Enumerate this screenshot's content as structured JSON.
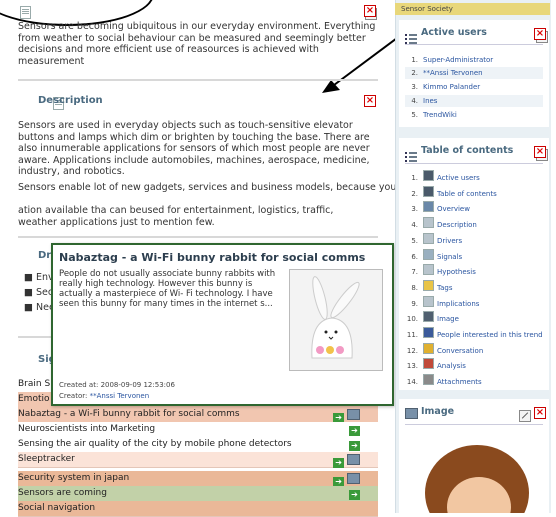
{
  "intro": {
    "text": "Sensors are becoming ubiquitous in our everyday environment. Everything from weather to social behaviour can be measured and seemingly better decisions and more efficient use of reasources is achieved with measurement"
  },
  "description": {
    "title": "Description",
    "para1": "Sensors are used in everyday objects such as touch-sensitive elevator buttons and lamps which dim or brighten by touching the base. There are also innumerable applications for sensors of which most people are never aware. Applications include automobiles, machines, aerospace, medicine, industry, and robotics.",
    "para2_line1": "Sensors enable lot of new gadgets, services and business models, because you have so much new informat",
    "para2_line2": "ation available tha can beused for entertainment, logistics, traffic, weather applications just to mention few."
  },
  "drivers": {
    "title_visible": "Dri",
    "items_visible": [
      "Env",
      "Sec",
      "Nee"
    ]
  },
  "signals": {
    "title_visible": "Sig",
    "rows": [
      {
        "text": "Brain S",
        "color": "#ffffff",
        "icons": []
      },
      {
        "text": "Emotio",
        "color": "#f1c6b0",
        "icons": []
      },
      {
        "text": "Nabaztag - a Wi-Fi bunny rabbit for social comms",
        "color": "#f1c6b0",
        "icons": [
          "go",
          "img"
        ]
      },
      {
        "text": "Neuroscientists into Marketing",
        "color": "#ffffff",
        "icons": [
          "go"
        ]
      },
      {
        "text": "Sensing the air quality of the city by mobile phone detectors",
        "color": "#ffffff",
        "icons": [
          "go"
        ]
      },
      {
        "text": "Sleeptracker",
        "color": "#fbe3d8",
        "icons": [
          "go",
          "img"
        ]
      },
      {
        "text": "Security system in japan",
        "color": "#eab898",
        "icons": [
          "go",
          "img"
        ]
      },
      {
        "text": "Sensors are coming",
        "color": "#c2d1a8",
        "icons": [
          "go"
        ]
      },
      {
        "text": "Social navigation",
        "color": "#eab898",
        "icons": []
      }
    ]
  },
  "popup": {
    "title": "Nabaztag - a Wi-Fi bunny rabbit for social comms",
    "text": "People do not usually associate bunny rabbits with really high technology. However this bunny is actually a masterpiece of Wi- Fi technology. I have seen this bunny for many times in the internet s...",
    "created_label": "Created at:",
    "created_value": "2008-09-09 12:53:06",
    "creator_label": "Creator:",
    "creator_value": "**Anssi Tervonen"
  },
  "right_panel": {
    "tab_label": "Sensor Society",
    "active_users": {
      "title": "Active users",
      "items": [
        {
          "num": "1.",
          "name": "Super-Administrator"
        },
        {
          "num": "2.",
          "name": "**Anssi Tervonen"
        },
        {
          "num": "3.",
          "name": "Kimmo Palander"
        },
        {
          "num": "4.",
          "name": "Ines"
        },
        {
          "num": "5.",
          "name": "TrendWiki"
        }
      ]
    },
    "toc": {
      "title": "Table of contents",
      "items": [
        {
          "num": "1.",
          "label": "Active users",
          "icon": "list-icon"
        },
        {
          "num": "2.",
          "label": "Table of contents",
          "icon": "list-icon"
        },
        {
          "num": "3.",
          "label": "Overview",
          "icon": "window-icon"
        },
        {
          "num": "4.",
          "label": "Description",
          "icon": "doc-icon"
        },
        {
          "num": "5.",
          "label": "Drivers",
          "icon": "doc-icon"
        },
        {
          "num": "6.",
          "label": "Signals",
          "icon": "signals-icon"
        },
        {
          "num": "7.",
          "label": "Hypothesis",
          "icon": "doc-icon"
        },
        {
          "num": "8.",
          "label": "Tags",
          "icon": "tags-icon"
        },
        {
          "num": "9.",
          "label": "Implications",
          "icon": "doc-icon"
        },
        {
          "num": "10.",
          "label": "Image",
          "icon": "image-icon"
        },
        {
          "num": "11.",
          "label": "People interested in this trend",
          "icon": "people-icon"
        },
        {
          "num": "12.",
          "label": "Conversation",
          "icon": "conversation-icon"
        },
        {
          "num": "13.",
          "label": "Analysis",
          "icon": "analysis-icon"
        },
        {
          "num": "14.",
          "label": "Attachments",
          "icon": "attachment-icon"
        }
      ]
    },
    "image": {
      "title": "Image"
    }
  }
}
